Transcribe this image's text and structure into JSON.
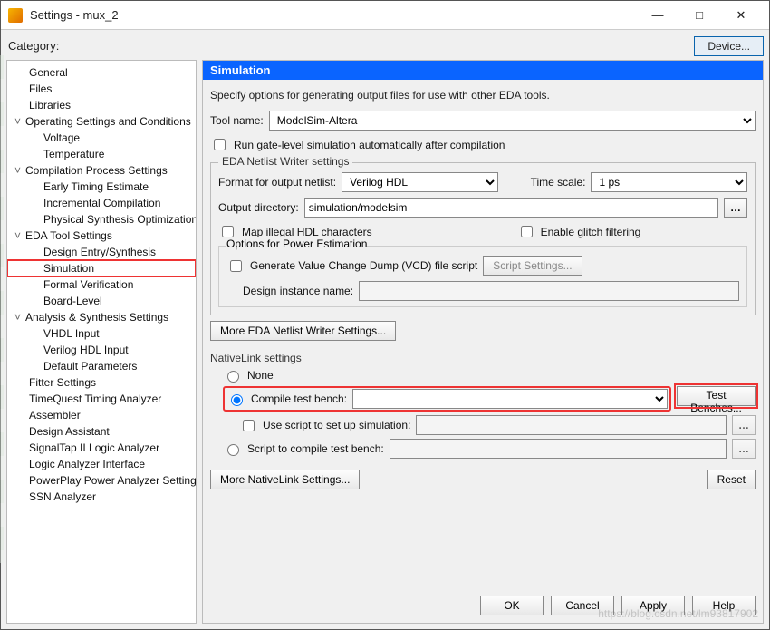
{
  "window": {
    "title": "Settings - mux_2",
    "min_label": "—",
    "max_label": "□",
    "close_label": "✕"
  },
  "category_label": "Category:",
  "device_button": "Device...",
  "tree": {
    "general": "General",
    "files": "Files",
    "libraries": "Libraries",
    "op_settings": "Operating Settings and Conditions",
    "voltage": "Voltage",
    "temperature": "Temperature",
    "comp_proc": "Compilation Process Settings",
    "early_timing": "Early Timing Estimate",
    "incr_comp": "Incremental Compilation",
    "phys_synth": "Physical Synthesis Optimization",
    "eda_tool": "EDA Tool Settings",
    "design_entry": "Design Entry/Synthesis",
    "simulation": "Simulation",
    "formal_ver": "Formal Verification",
    "board_level": "Board-Level",
    "analysis_synth": "Analysis & Synthesis Settings",
    "vhdl_input": "VHDL Input",
    "verilog_input": "Verilog HDL Input",
    "default_params": "Default Parameters",
    "fitter": "Fitter Settings",
    "timequest": "TimeQuest Timing Analyzer",
    "assembler": "Assembler",
    "design_assist": "Design Assistant",
    "signaltap": "SignalTap II Logic Analyzer",
    "logic_ana_if": "Logic Analyzer Interface",
    "powerplay": "PowerPlay Power Analyzer Settings",
    "ssn": "SSN Analyzer"
  },
  "panel": {
    "header": "Simulation",
    "description": "Specify options for generating output files for use with other EDA tools.",
    "tool_name_label": "Tool name:",
    "tool_name_value": "ModelSim-Altera",
    "run_gate_label": "Run gate-level simulation automatically after compilation",
    "netlist_legend": "EDA Netlist Writer settings",
    "format_label": "Format for output netlist:",
    "format_value": "Verilog HDL",
    "timescale_label": "Time scale:",
    "timescale_value": "1 ps",
    "outdir_label": "Output directory:",
    "outdir_value": "simulation/modelsim",
    "map_illegal_label": "Map illegal HDL characters",
    "enable_glitch_label": "Enable glitch filtering",
    "power_legend": "Options for Power Estimation",
    "gen_vcd_label": "Generate Value Change Dump (VCD) file script",
    "script_settings_btn": "Script Settings...",
    "design_instance_label": "Design instance name:",
    "more_eda_btn": "More EDA Netlist Writer Settings...",
    "nativelink_legend": "NativeLink settings",
    "none_label": "None",
    "compile_tb_label": "Compile test bench:",
    "test_benches_btn": "Test Benches...",
    "use_script_label": "Use script to set up simulation:",
    "script_compile_label": "Script to compile test bench:",
    "more_nativelink_btn": "More NativeLink Settings...",
    "reset_btn": "Reset"
  },
  "footer": {
    "ok": "OK",
    "cancel": "Cancel",
    "apply": "Apply",
    "help": "Help"
  },
  "watermark": "https://blog.csdn.net/lm93817902"
}
